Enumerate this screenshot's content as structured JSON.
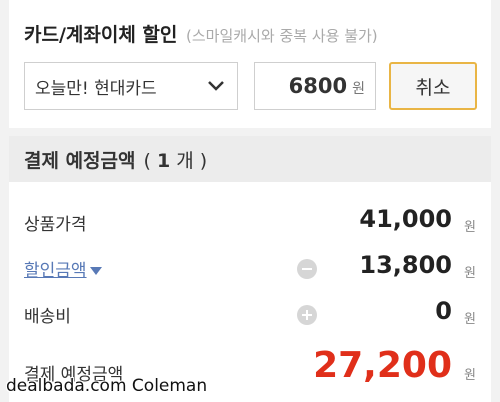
{
  "discount": {
    "title": "카드/계좌이체 할인",
    "note": "(스마일캐시와 중복 사용 불가)",
    "selected_card": "오늘만! 현대카드",
    "amount": "6800",
    "amount_unit": "원",
    "cancel_label": "취소"
  },
  "section": {
    "title": "결제 예정금액",
    "count_open": "(",
    "count_value": "1",
    "count_suffix": "개 )"
  },
  "summary": {
    "rows": [
      {
        "label": "상품가격",
        "value": "41,000",
        "unit": "원"
      },
      {
        "label": "할인금액",
        "value": "13,800",
        "unit": "원"
      },
      {
        "label": "배송비",
        "value": "0",
        "unit": "원"
      }
    ],
    "total": {
      "label": "결제 예정금액",
      "value": "27,200",
      "unit": "원"
    }
  },
  "watermark": "dealbada.com  Coleman",
  "colors": {
    "accent_border": "#e9b545",
    "total_red": "#e02f1a",
    "link_blue": "#5879b6"
  }
}
